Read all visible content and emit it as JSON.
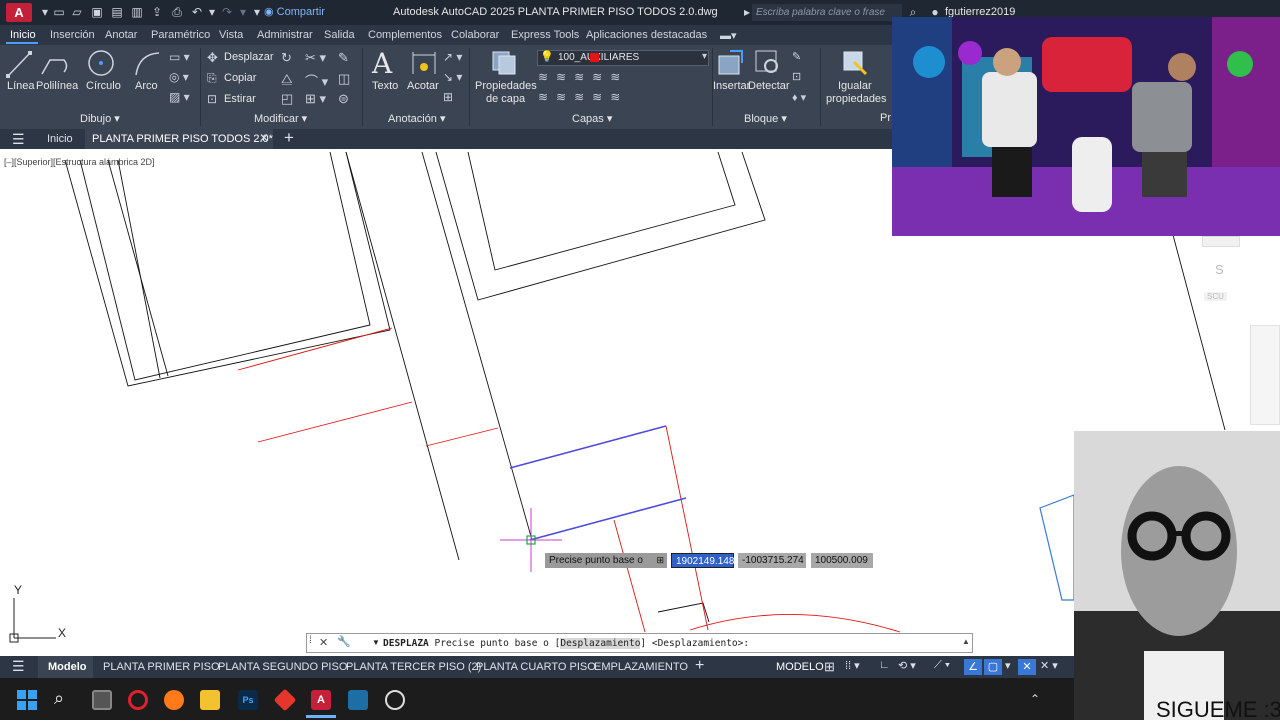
{
  "titlebar": {
    "logo": "A",
    "share_label": "Compartir",
    "title": "Autodesk AutoCAD 2025    PLANTA PRIMER PISO TODOS 2.0.dwg",
    "search_placeholder": "Escriba palabra clave o frase",
    "user": "fgutierrez2019"
  },
  "ribbon_tabs": [
    "Inicio",
    "Inserción",
    "Anotar",
    "Paramétrico",
    "Vista",
    "Administrar",
    "Salida",
    "Complementos",
    "Colaborar",
    "Express Tools",
    "Aplicaciones destacadas"
  ],
  "ribbon": {
    "draw": {
      "linea": "Línea",
      "polilinea": "Polilínea",
      "circulo": "Círculo",
      "arco": "Arco",
      "panel": "Dibujo"
    },
    "modify": {
      "desplazar": "Desplazar",
      "copiar": "Copiar",
      "estirar": "Estirar",
      "panel": "Modificar"
    },
    "annotation": {
      "texto": "Texto",
      "acotar": "Acotar",
      "panel": "Anotación"
    },
    "layers": {
      "propiedades": "Propiedades",
      "de_capa": "de capa",
      "current_layer": "100_AUXILIARES",
      "layer_color": "#e31414",
      "panel": "Capas"
    },
    "block": {
      "insertar": "Insertar",
      "detectar": "Detectar",
      "panel": "Bloque"
    },
    "properties": {
      "igualar": "Igualar",
      "propiedades": "propiedades",
      "panel_cut": "Pr"
    }
  },
  "file_tabs": {
    "home": "Inicio",
    "active": "PLANTA PRIMER PISO TODOS 2.0*"
  },
  "viewport_label": "[–][Superior][Estructura alámbrica 2D]",
  "dynamic_input": {
    "prompt": "Precise punto base o",
    "x": "1902149.148",
    "y": "-1003715.274",
    "z": "100500.009"
  },
  "command": {
    "name": "DESPLAZA",
    "prompt": "Precise punto base o [",
    "option": "Desplazamiento",
    "tail": "] <Desplazamiento>:"
  },
  "ucs": {
    "x": "X",
    "y": "Y"
  },
  "layout_tabs": [
    "Modelo",
    "PLANTA PRIMER PISO",
    "PLANTA SEGUNDO PISO",
    "PLANTA TERCER PISO (2)",
    "PLANTA CUARTO PISO",
    "EMPLAZAMIENTO"
  ],
  "status": {
    "model": "MODELO"
  },
  "overlay_text": {
    "sigueme": "SIGUEME :3",
    "nav_s": "S",
    "nav_scu": "SCU"
  }
}
